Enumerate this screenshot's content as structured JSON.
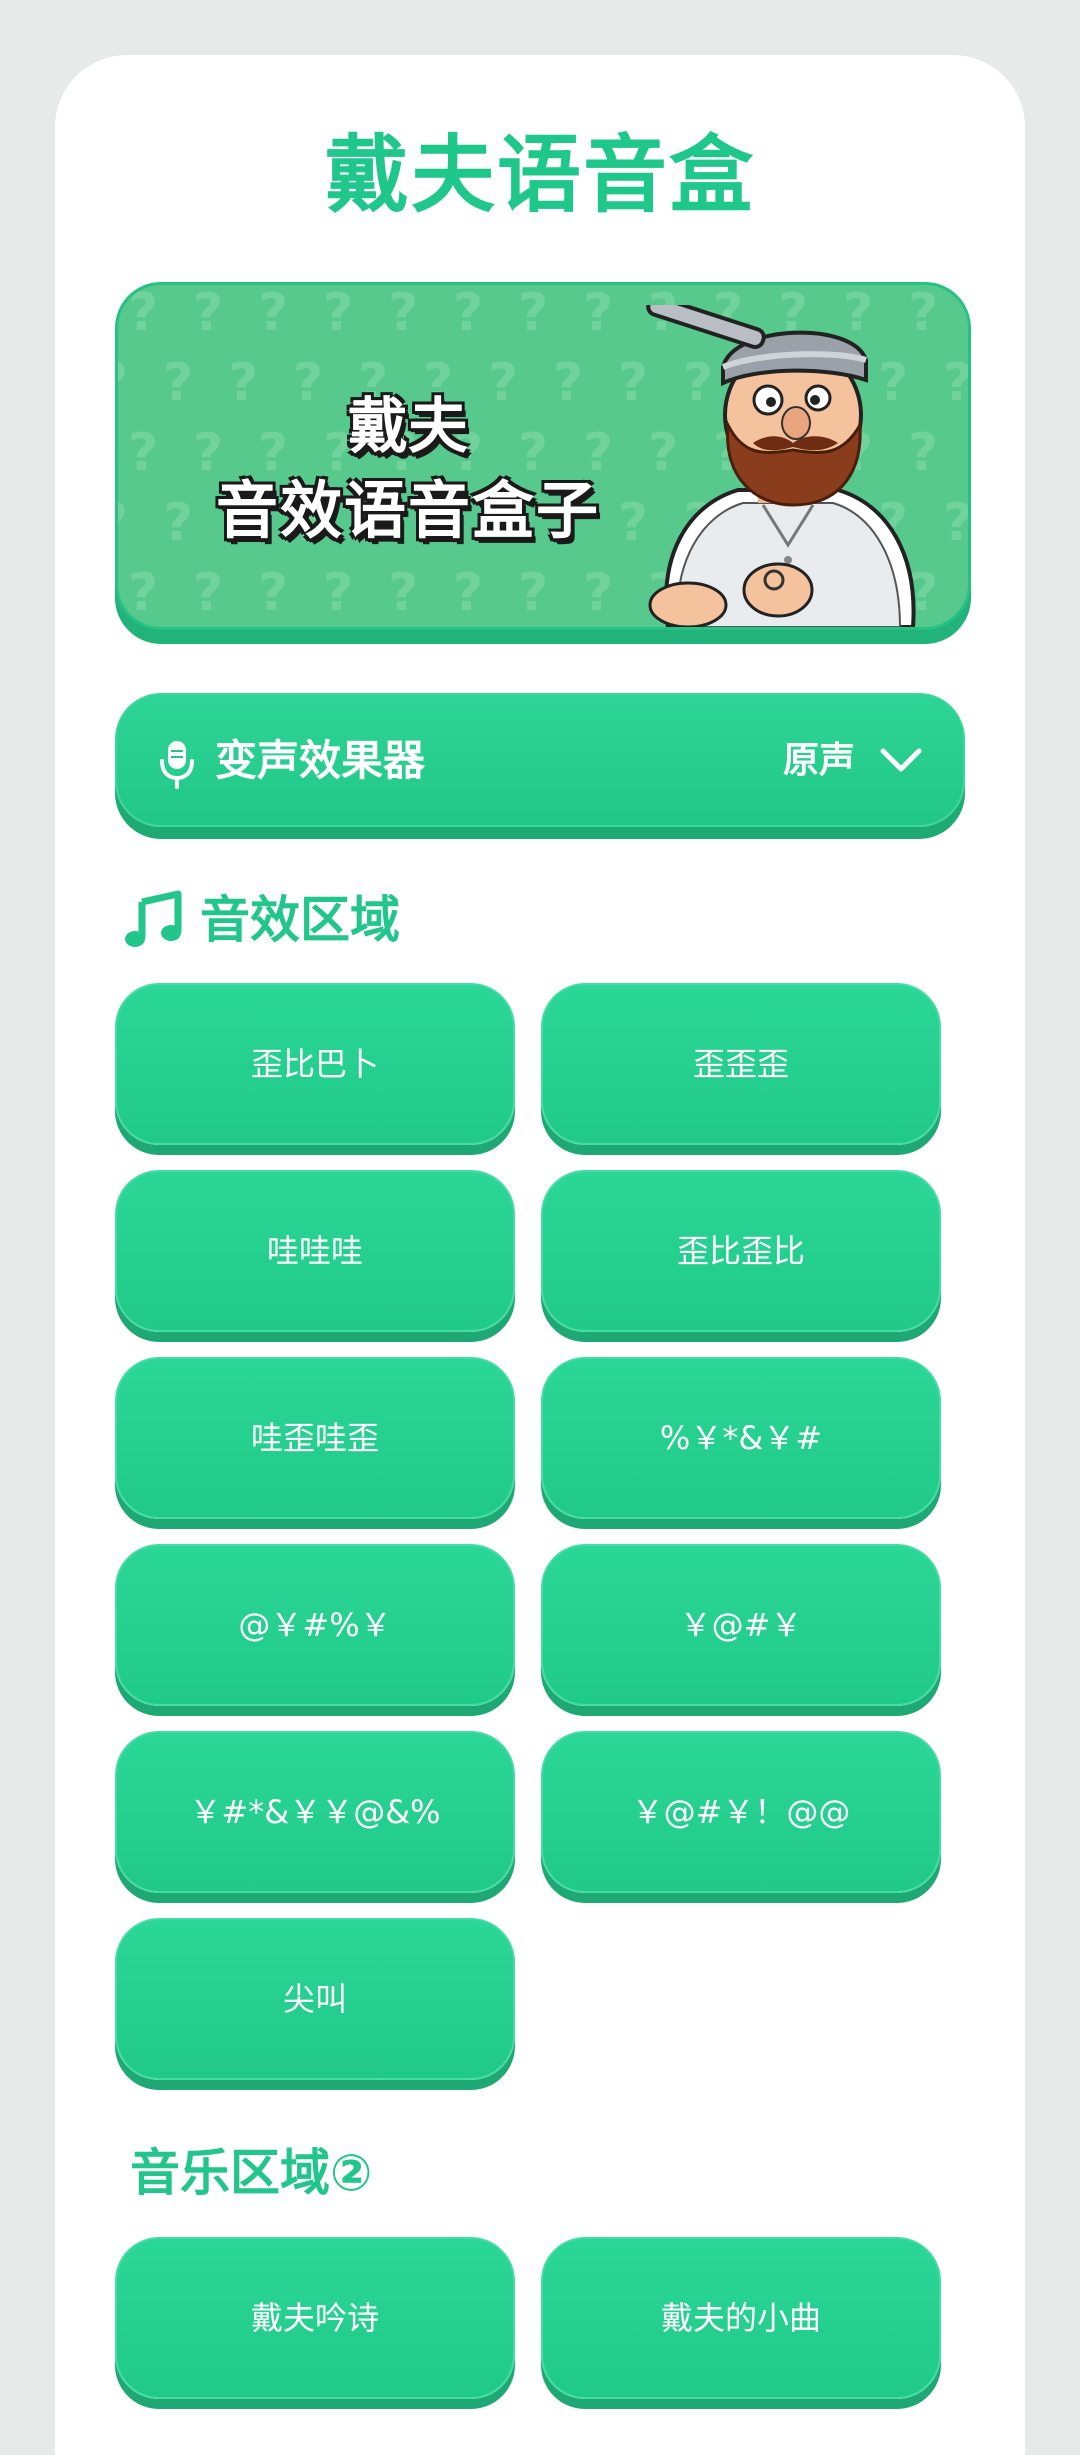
{
  "app": {
    "title": "戴夫语音盒"
  },
  "banner": {
    "line1": "戴夫",
    "line2": "音效语音盒子",
    "image": "crazy-dave-character"
  },
  "voice_changer": {
    "icon": "microphone-icon",
    "label": "变声效果器",
    "selected": "原声"
  },
  "sfx_section": {
    "icon": "music-note-icon",
    "heading": "音效区域",
    "buttons": [
      "歪比巴卜",
      "歪歪歪",
      "哇哇哇",
      "歪比歪比",
      "哇歪哇歪",
      "%￥*&￥#",
      "@￥#%￥",
      "￥@#￥",
      "￥#*&￥￥@&%",
      "￥@#￥！@@",
      "尖叫"
    ]
  },
  "music_section": {
    "heading": "音乐区域②",
    "buttons": [
      "戴夫吟诗",
      "戴夫的小曲"
    ]
  },
  "colors": {
    "accent": "#22c58a",
    "button": "#24cf8e",
    "button_shadow": "#1ea873",
    "banner_bg": "#58c98c",
    "page_bg": "#e6ebe9"
  }
}
